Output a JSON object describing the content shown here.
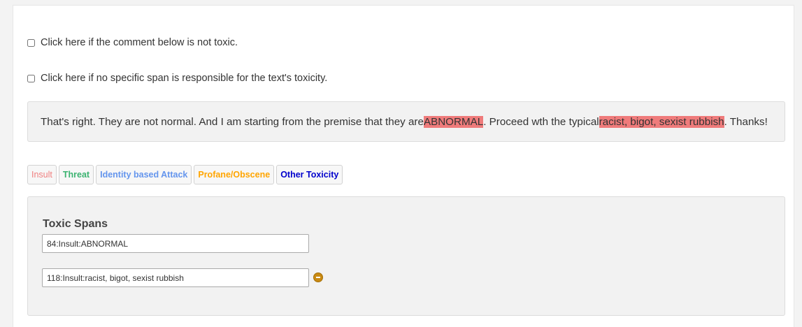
{
  "checks": {
    "not_toxic": "Click here if the comment below is not toxic.",
    "no_span": "Click here if no specific span is responsible for the text's toxicity."
  },
  "comment": {
    "part1": "That's right. They are not normal. And I am starting from the premise that they are ",
    "highlight1": "ABNORMAL",
    "part2": ". Proceed wth the typical ",
    "highlight2": "racist, bigot, sexist rubbish",
    "part3": ". Thanks!"
  },
  "labels": [
    {
      "text": "Insult",
      "color": "#f08080"
    },
    {
      "text": "Threat",
      "color": "#3cb371"
    },
    {
      "text": "Identity based Attack",
      "color": "#6495ed"
    },
    {
      "text": "Profane/Obscene",
      "color": "#ffa500"
    },
    {
      "text": "Other Toxicity",
      "color": "#0000cd"
    }
  ],
  "spans": {
    "title": "Toxic Spans",
    "items": [
      {
        "value": "84:Insult:ABNORMAL"
      },
      {
        "value": "118:Insult:racist, bigot, sexist rubbish"
      }
    ]
  },
  "colors": {
    "highlight": "#ef7b7b",
    "remove_icon": "#c98a12"
  }
}
